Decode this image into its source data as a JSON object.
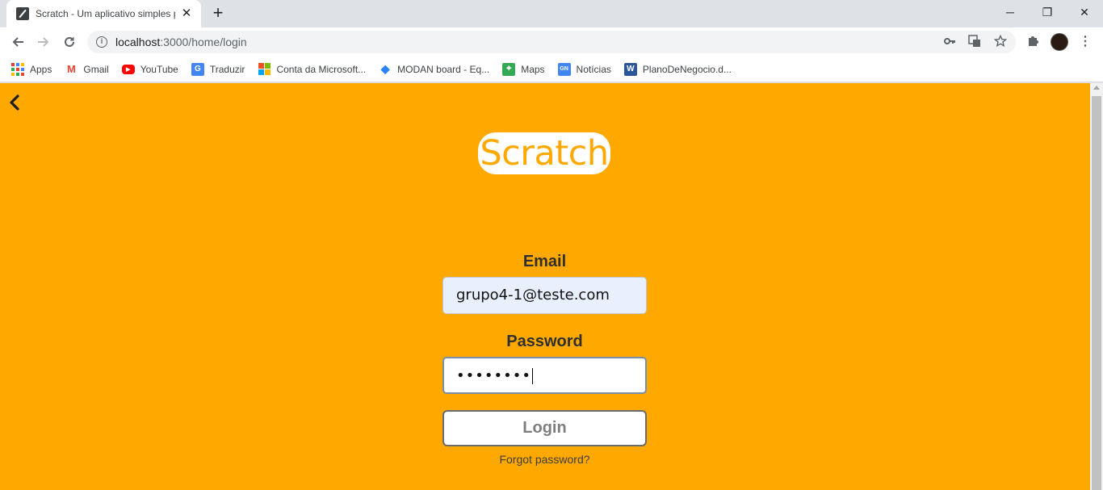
{
  "browser": {
    "tab_title": "Scratch - Um aplicativo simples p",
    "url_host": "localhost",
    "url_path": ":3000/home/login",
    "new_tab": "+",
    "close_tab": "✕",
    "window_controls": {
      "minimize": "─",
      "restore": "❐",
      "close": "✕"
    }
  },
  "bookmarks": [
    {
      "label": "Apps",
      "icon": "apps-grid-icon"
    },
    {
      "label": "Gmail",
      "icon": "gmail-icon",
      "color": "#ea4335",
      "glyph": "M"
    },
    {
      "label": "YouTube",
      "icon": "youtube-icon",
      "color": "#ff0000",
      "glyph": "▶"
    },
    {
      "label": "Traduzir",
      "icon": "google-translate-icon",
      "color": "#4285f4",
      "glyph": "G"
    },
    {
      "label": "Conta da Microsoft...",
      "icon": "microsoft-icon"
    },
    {
      "label": "MODAN board - Eq...",
      "icon": "jira-icon",
      "color": "#2684ff",
      "glyph": "◆"
    },
    {
      "label": "Maps",
      "icon": "google-maps-icon",
      "color": "#34a853",
      "glyph": "⌖"
    },
    {
      "label": "Notícias",
      "icon": "google-news-icon",
      "color": "#4285f4",
      "glyph": "GN"
    },
    {
      "label": "PlanoDeNegocio.d...",
      "icon": "word-icon",
      "color": "#2b579a",
      "glyph": "W"
    }
  ],
  "page": {
    "background": "#ffa900",
    "logo_text": "Scratch",
    "email_label": "Email",
    "email_value": "grupo4-1@teste.com",
    "password_label": "Password",
    "password_masked": "••••••••",
    "login_label": "Login",
    "forgot_label": "Forgot password?"
  }
}
